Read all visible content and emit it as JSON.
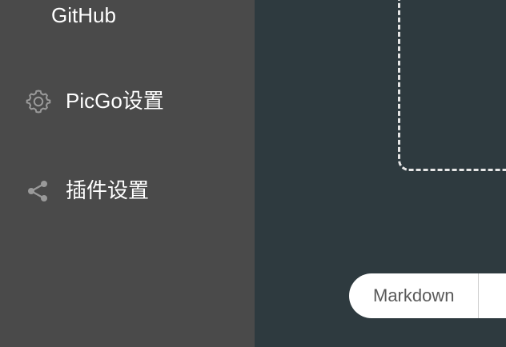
{
  "sidebar": {
    "items": [
      {
        "label": "GitHub",
        "icon": ""
      },
      {
        "label": "PicGo设置",
        "icon": "gear-icon"
      },
      {
        "label": "插件设置",
        "icon": "share-icon"
      }
    ]
  },
  "main": {
    "format_options": [
      "Markdown"
    ]
  },
  "colors": {
    "sidebar_bg": "#4a4a4a",
    "main_bg": "#2e3a3f",
    "icon": "#9a9a9a",
    "text": "#ffffff",
    "dashed_border": "#e6e6e6"
  }
}
